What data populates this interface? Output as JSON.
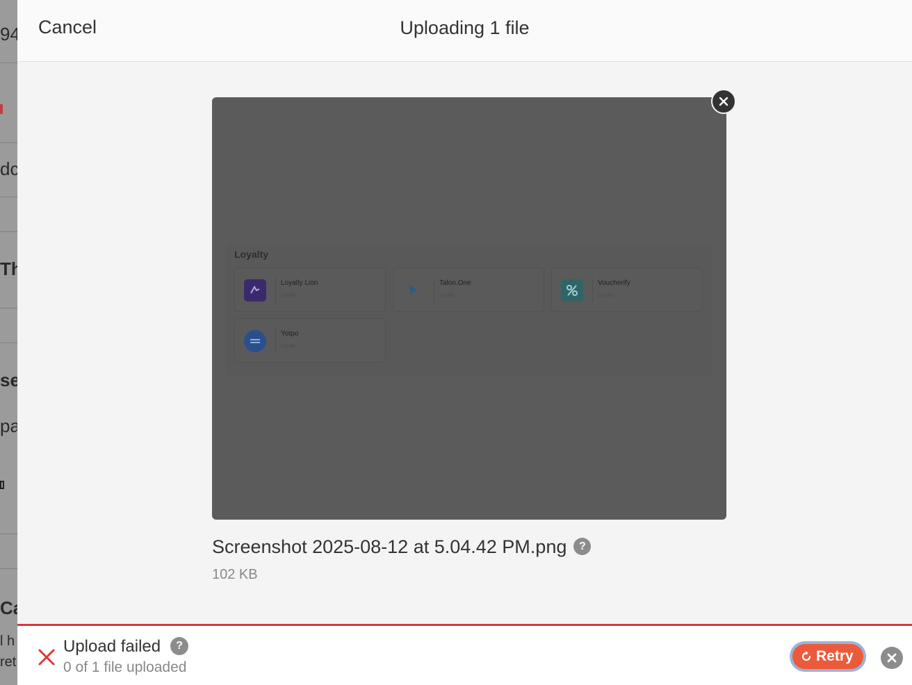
{
  "background_page": {
    "fragments": [
      "94",
      "dc",
      "Th",
      "se",
      "pa",
      "Ca",
      "l h",
      "ret"
    ]
  },
  "header": {
    "cancel_label": "Cancel",
    "title": "Uploading 1 file"
  },
  "file": {
    "name": "Screenshot 2025-08-12 at 5.04.42 PM.png",
    "size": "102 KB",
    "help_glyph": "?",
    "remove_icon": "close-icon"
  },
  "preview": {
    "section_title": "Loyalty",
    "cards": [
      {
        "name": "Loyalty Lion",
        "category": "Loyalty",
        "logo": "loyalty-lion-logo",
        "color": "#3b2a6b"
      },
      {
        "name": "Talon.One",
        "category": "Loyalty",
        "logo": "talon-one-logo",
        "color": "#5a5a5a"
      },
      {
        "name": "Voucherify",
        "category": "Loyalty",
        "logo": "voucherify-logo",
        "color": "#2f6468"
      },
      {
        "name": "Yotpo",
        "category": "Loyalty",
        "logo": "yotpo-logo",
        "color": "#2b4f8c"
      }
    ]
  },
  "status": {
    "title": "Upload failed",
    "subtitle": "0 of 1 file uploaded",
    "help_glyph": "?",
    "retry_label": "Retry",
    "error_color": "#d93838",
    "retry_color": "#ec5a3c"
  }
}
